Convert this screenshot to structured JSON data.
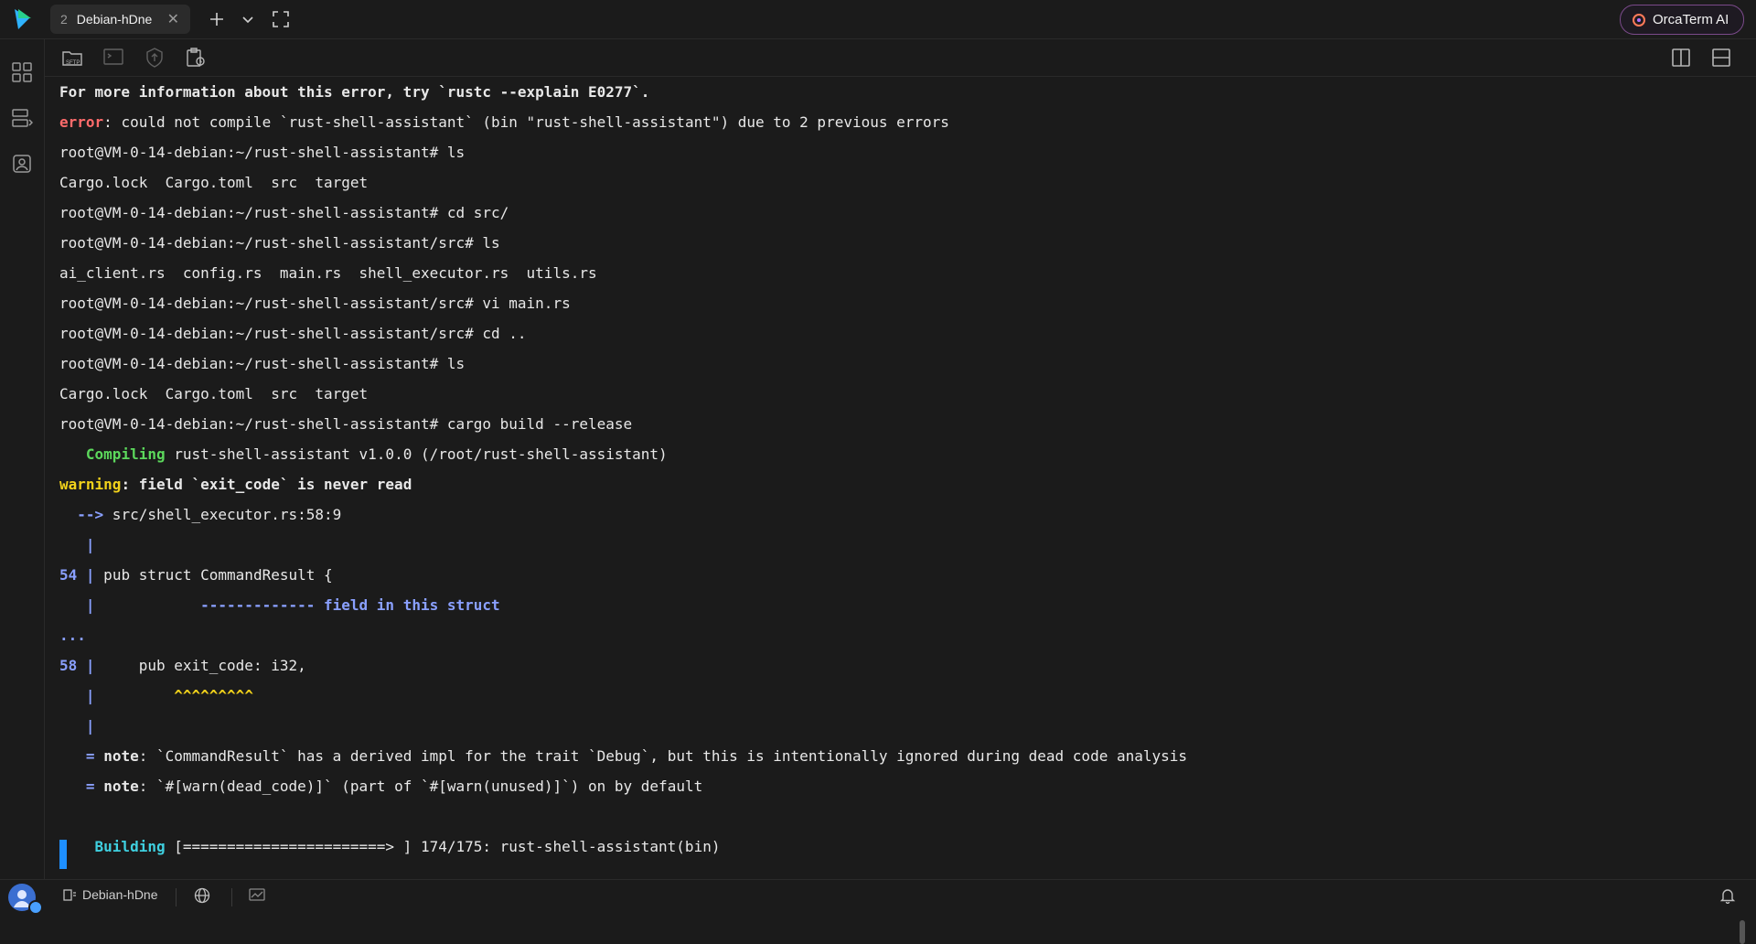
{
  "app": {
    "tab_number": "2",
    "tab_title": "Debian-hDne",
    "ai_button": "OrcaTerm AI"
  },
  "terminal": {
    "lines": [
      {
        "segments": [
          {
            "t": "For more information about this error, try `rustc --explain E0277`.",
            "c": "bold"
          }
        ]
      },
      {
        "segments": [
          {
            "t": "error",
            "c": "red"
          },
          {
            "t": ": could not compile `rust-shell-assistant` (bin \"rust-shell-assistant\") due to 2 previous errors",
            "c": ""
          }
        ]
      },
      {
        "segments": [
          {
            "t": "root@VM-0-14-debian:~/rust-shell-assistant# ls",
            "c": ""
          }
        ]
      },
      {
        "segments": [
          {
            "t": "Cargo.lock  Cargo.toml  src  target",
            "c": ""
          }
        ]
      },
      {
        "segments": [
          {
            "t": "root@VM-0-14-debian:~/rust-shell-assistant# cd src/",
            "c": ""
          }
        ]
      },
      {
        "segments": [
          {
            "t": "root@VM-0-14-debian:~/rust-shell-assistant/src# ls",
            "c": ""
          }
        ]
      },
      {
        "segments": [
          {
            "t": "ai_client.rs  config.rs  main.rs  shell_executor.rs  utils.rs",
            "c": ""
          }
        ]
      },
      {
        "segments": [
          {
            "t": "root@VM-0-14-debian:~/rust-shell-assistant/src# vi main.rs",
            "c": ""
          }
        ]
      },
      {
        "segments": [
          {
            "t": "root@VM-0-14-debian:~/rust-shell-assistant/src# cd ..",
            "c": ""
          }
        ]
      },
      {
        "segments": [
          {
            "t": "root@VM-0-14-debian:~/rust-shell-assistant# ls",
            "c": ""
          }
        ]
      },
      {
        "segments": [
          {
            "t": "Cargo.lock  Cargo.toml  src  target",
            "c": ""
          }
        ]
      },
      {
        "segments": [
          {
            "t": "root@VM-0-14-debian:~/rust-shell-assistant# cargo build --release",
            "c": ""
          }
        ]
      },
      {
        "segments": [
          {
            "t": "   ",
            "c": ""
          },
          {
            "t": "Compiling",
            "c": "green"
          },
          {
            "t": " rust-shell-assistant v1.0.0 (/root/rust-shell-assistant)",
            "c": ""
          }
        ]
      },
      {
        "segments": [
          {
            "t": "warning",
            "c": "yellow"
          },
          {
            "t": ": field `exit_code` is never read",
            "c": "bold"
          }
        ]
      },
      {
        "segments": [
          {
            "t": "  ",
            "c": ""
          },
          {
            "t": "-->",
            "c": "blue"
          },
          {
            "t": " src/shell_executor.rs:58:9",
            "c": ""
          }
        ]
      },
      {
        "segments": [
          {
            "t": "   ",
            "c": ""
          },
          {
            "t": "|",
            "c": "blue"
          }
        ]
      },
      {
        "segments": [
          {
            "t": "54",
            "c": "blue"
          },
          {
            "t": " ",
            "c": ""
          },
          {
            "t": "|",
            "c": "blue"
          },
          {
            "t": " pub struct CommandResult {",
            "c": ""
          }
        ]
      },
      {
        "segments": [
          {
            "t": "   ",
            "c": ""
          },
          {
            "t": "|",
            "c": "blue"
          },
          {
            "t": "            ",
            "c": ""
          },
          {
            "t": "------------- field in this struct",
            "c": "blue"
          }
        ]
      },
      {
        "segments": [
          {
            "t": "...",
            "c": "blue"
          }
        ]
      },
      {
        "segments": [
          {
            "t": "58",
            "c": "blue"
          },
          {
            "t": " ",
            "c": ""
          },
          {
            "t": "|",
            "c": "blue"
          },
          {
            "t": "     pub exit_code: i32,",
            "c": ""
          }
        ]
      },
      {
        "segments": [
          {
            "t": "   ",
            "c": ""
          },
          {
            "t": "|",
            "c": "blue"
          },
          {
            "t": "         ",
            "c": ""
          },
          {
            "t": "^^^^^^^^^",
            "c": "caret"
          }
        ]
      },
      {
        "segments": [
          {
            "t": "   ",
            "c": ""
          },
          {
            "t": "|",
            "c": "blue"
          }
        ]
      },
      {
        "segments": [
          {
            "t": "   ",
            "c": ""
          },
          {
            "t": "=",
            "c": "blue"
          },
          {
            "t": " ",
            "c": ""
          },
          {
            "t": "note",
            "c": "bold"
          },
          {
            "t": ": `CommandResult` has a derived impl for the trait `Debug`, but this is intentionally ignored during dead code analysis",
            "c": ""
          }
        ]
      },
      {
        "segments": [
          {
            "t": "   ",
            "c": ""
          },
          {
            "t": "=",
            "c": "blue"
          },
          {
            "t": " ",
            "c": ""
          },
          {
            "t": "note",
            "c": "bold"
          },
          {
            "t": ": `#[warn(dead_code)]` (part of `#[warn(unused)]`) on by default",
            "c": ""
          }
        ]
      },
      {
        "segments": []
      },
      {
        "segments": [
          {
            "t": "    ",
            "c": ""
          },
          {
            "t": "Building",
            "c": "cyan"
          },
          {
            "t": " [=======================> ] 174/175: rust-shell-assistant(bin)",
            "c": ""
          }
        ]
      }
    ]
  },
  "statusbar": {
    "host": "Debian-hDne"
  },
  "icons": {
    "toolbar": [
      "sftp-icon",
      "ftp-icon",
      "upload-icon",
      "snapshot-icon"
    ],
    "rail": [
      "apps-icon",
      "servers-icon",
      "history-icon"
    ]
  }
}
